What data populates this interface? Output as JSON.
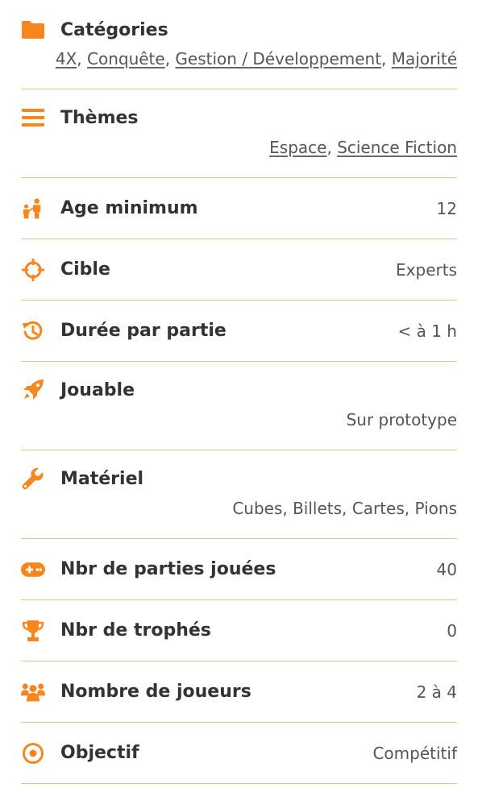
{
  "accent_color": "#f7861e",
  "divider_color": "#b3d98a",
  "rows": {
    "categories": {
      "icon": "folder-icon",
      "label": "Catégories",
      "links": [
        "4X",
        "Conquête",
        "Gestion / Développement",
        "Majorité"
      ]
    },
    "themes": {
      "icon": "bars-icon",
      "label": "Thèmes",
      "links": [
        "Espace",
        "Science Fiction"
      ]
    },
    "age": {
      "icon": "family-icon",
      "label": "Age minimum",
      "value": "12"
    },
    "target": {
      "icon": "crosshair-icon",
      "label": "Cible",
      "value": "Experts"
    },
    "duration": {
      "icon": "history-icon",
      "label": "Durée par partie",
      "value": "< à 1 h"
    },
    "playable": {
      "icon": "rocket-icon",
      "label": "Jouable",
      "value": "Sur prototype"
    },
    "material": {
      "icon": "wrench-icon",
      "label": "Matériel",
      "value": "Cubes, Billets, Cartes, Pions"
    },
    "games_played": {
      "icon": "gamepad-icon",
      "label": "Nbr de parties jouées",
      "value": "40"
    },
    "trophies": {
      "icon": "trophy-icon",
      "label": "Nbr de trophés",
      "value": "0"
    },
    "players": {
      "icon": "users-icon",
      "label": "Nombre de joueurs",
      "value": "2 à 4"
    },
    "objective": {
      "icon": "target-icon",
      "label": "Objectif",
      "value": "Compétitif"
    }
  },
  "separator": ", "
}
